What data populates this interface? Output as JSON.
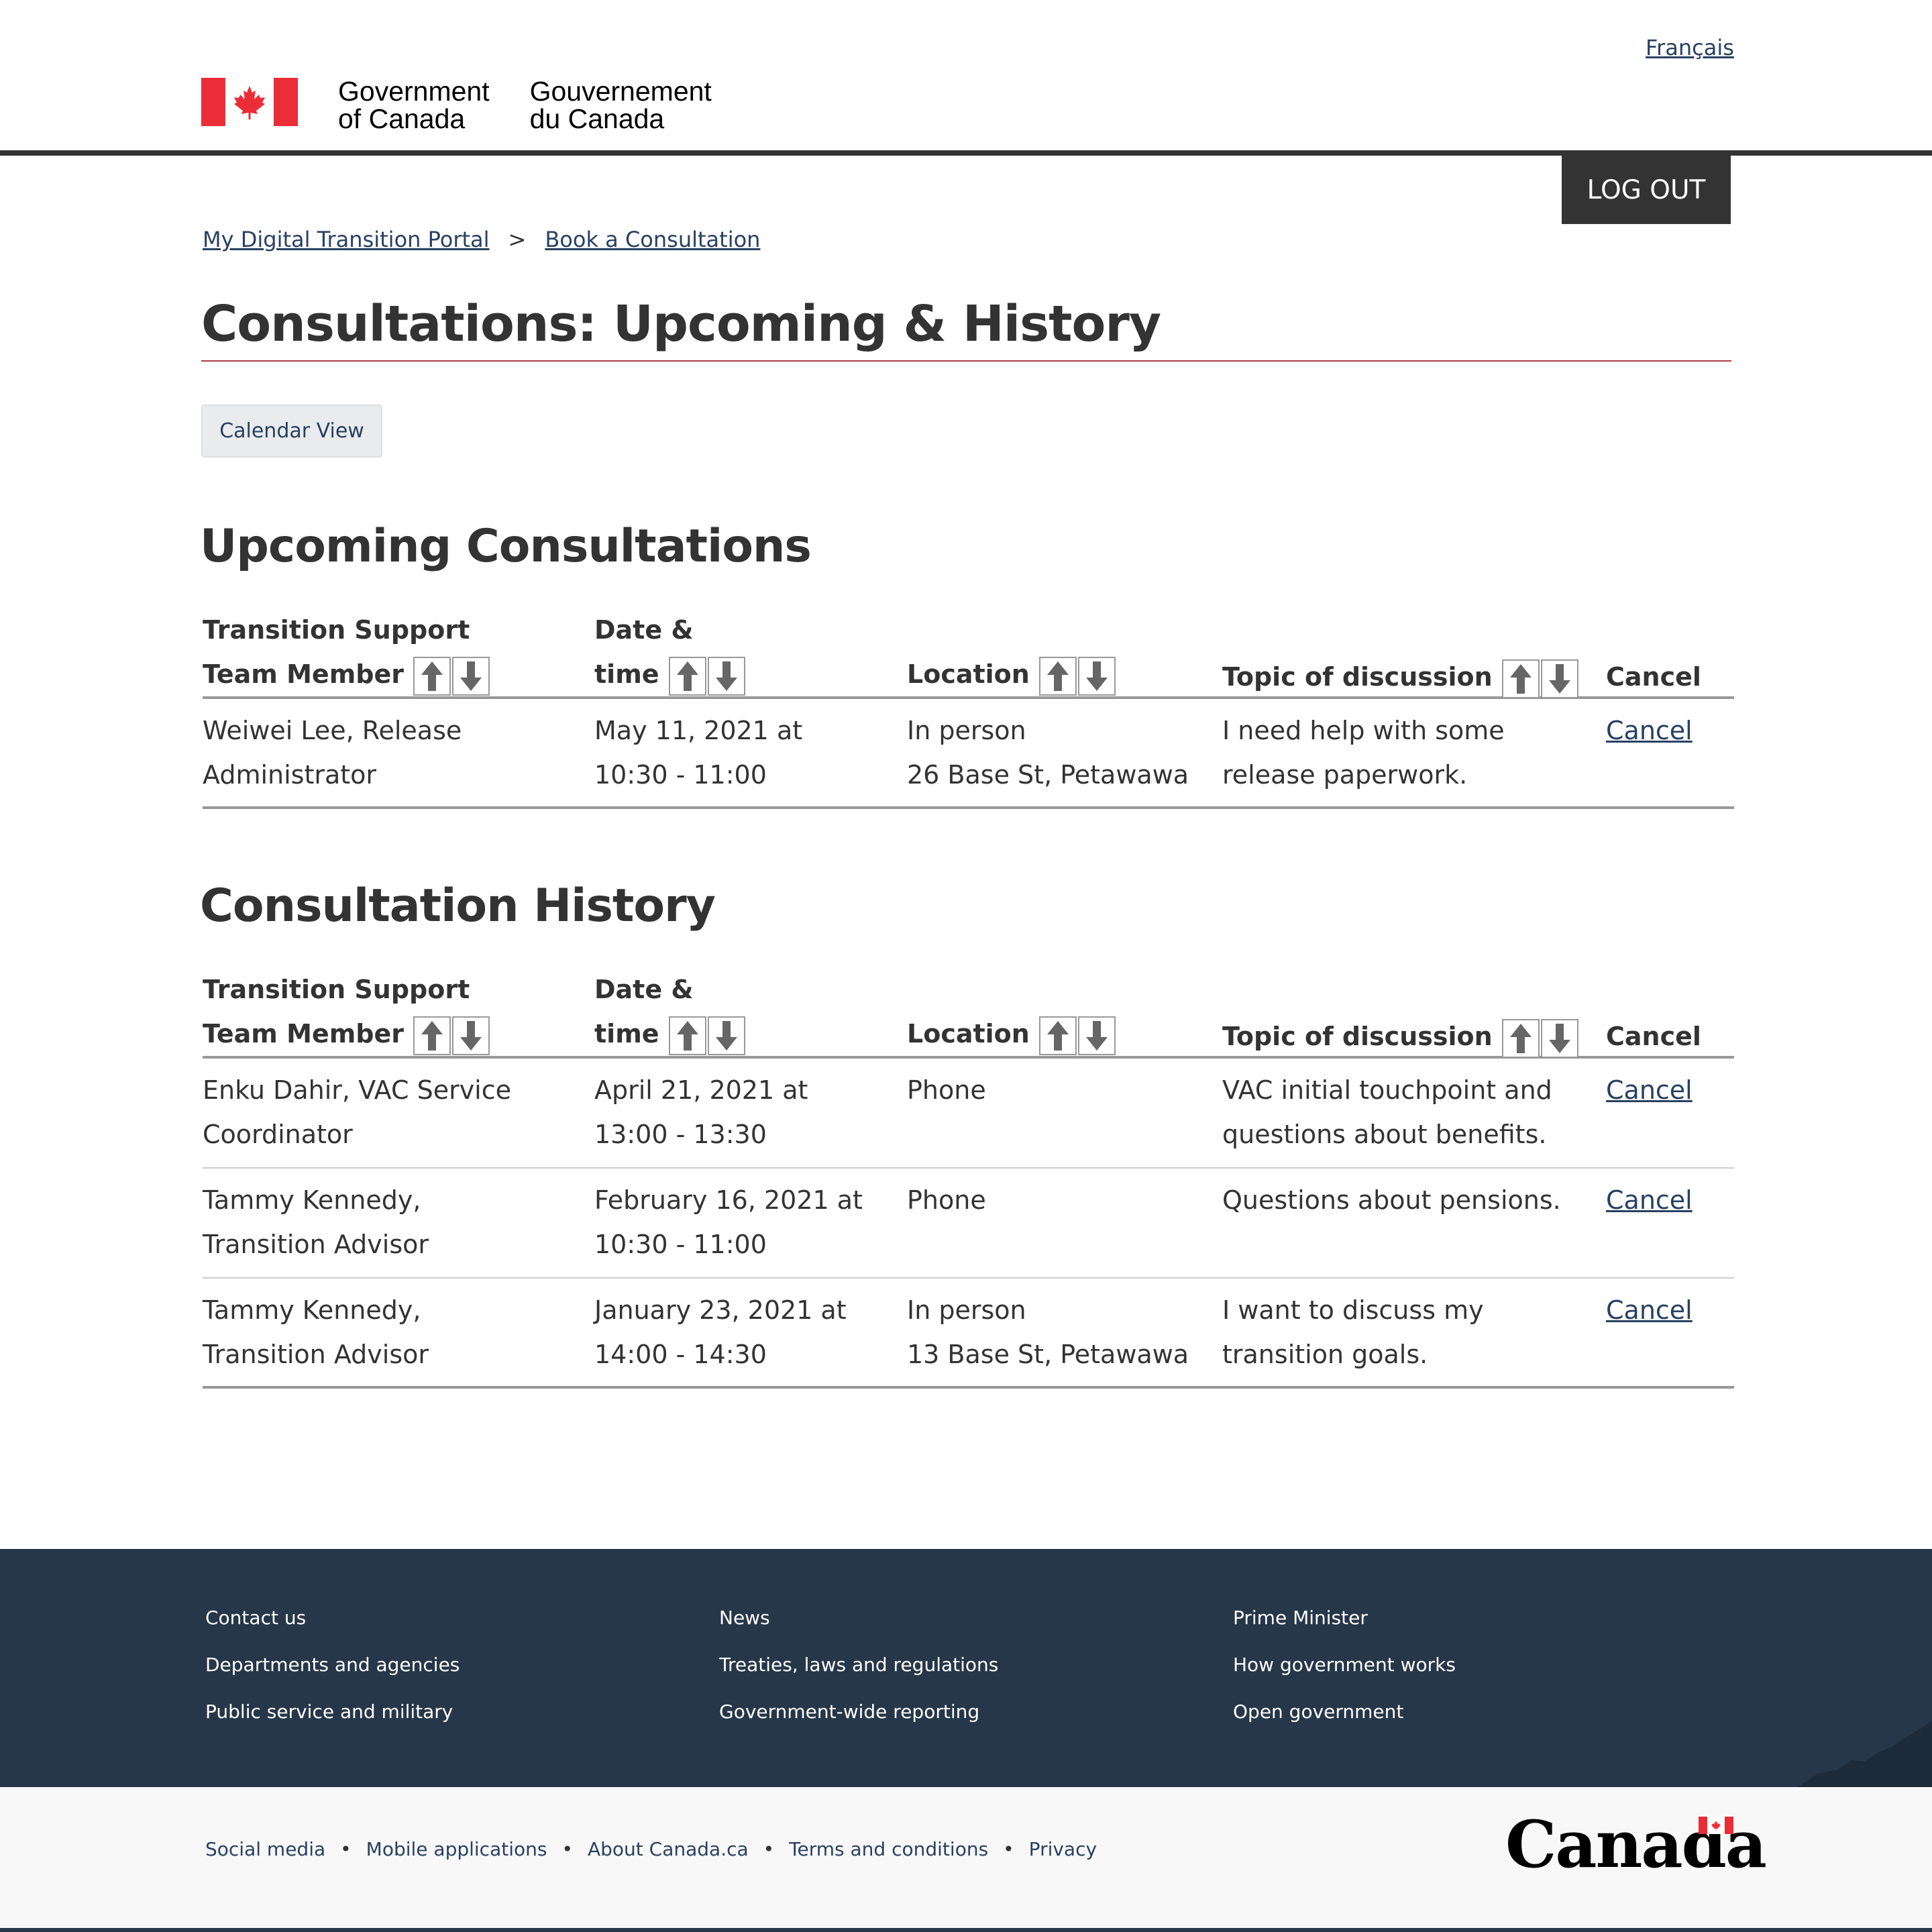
{
  "header": {
    "language_link": "Français",
    "signature_en_line1": "Government",
    "signature_en_line2": "of Canada",
    "signature_fr_line1": "Gouvernement",
    "signature_fr_line2": "du Canada",
    "logout_label": "LOG OUT"
  },
  "breadcrumb": {
    "items": [
      "My Digital Transition Portal",
      "Book a Consultation"
    ],
    "separator": ">"
  },
  "page": {
    "title": "Consultations: Upcoming & History",
    "calendar_button": "Calendar View"
  },
  "columns": {
    "member_line1": "Transition Support",
    "member_line2": "Team Member",
    "date_line1": "Date &",
    "date_line2": "time",
    "location": "Location",
    "topic": "Topic of discussion",
    "cancel": "Cancel"
  },
  "upcoming": {
    "title": "Upcoming Consultations",
    "rows": [
      {
        "member_line1": "Weiwei Lee, Release",
        "member_line2": "Administrator",
        "date_line1": "May 11, 2021 at",
        "date_line2": "10:30 - 11:00",
        "location_line1": "In person",
        "location_line2": "26 Base St, Petawawa",
        "topic_line1": "I need help with some",
        "topic_line2": "release paperwork.",
        "cancel": "Cancel"
      }
    ]
  },
  "history": {
    "title": "Consultation History",
    "rows": [
      {
        "member_line1": "Enku Dahir, VAC Service",
        "member_line2": "Coordinator",
        "date_line1": "April 21, 2021 at",
        "date_line2": "13:00 - 13:30",
        "location_line1": "Phone",
        "location_line2": "",
        "topic_line1": "VAC initial touchpoint and",
        "topic_line2": "questions about benefits.",
        "cancel": "Cancel"
      },
      {
        "member_line1": "Tammy Kennedy,",
        "member_line2": "Transition Advisor",
        "date_line1": "February 16, 2021 at",
        "date_line2": "10:30 - 11:00",
        "location_line1": "Phone",
        "location_line2": "",
        "topic_line1": "Questions about pensions.",
        "topic_line2": "",
        "cancel": "Cancel"
      },
      {
        "member_line1": "Tammy Kennedy,",
        "member_line2": "Transition Advisor",
        "date_line1": "January 23, 2021 at",
        "date_line2": "14:00 - 14:30",
        "location_line1": "In person",
        "location_line2": "13 Base St, Petawawa",
        "topic_line1": "I want to discuss my",
        "topic_line2": "transition goals.",
        "cancel": "Cancel"
      }
    ]
  },
  "footer": {
    "col1": [
      "Contact us",
      "Departments and agencies",
      "Public service and military"
    ],
    "col2": [
      "News",
      "Treaties, laws and regulations",
      "Government-wide reporting"
    ],
    "col3": [
      "Prime Minister",
      "How government works",
      "Open government"
    ],
    "sub_links": [
      "Social media",
      "Mobile applications",
      "About Canada.ca",
      "Terms and conditions",
      "Privacy"
    ],
    "wordmark": "Canada"
  },
  "colors": {
    "link": "#284162",
    "flag_red": "#eb2d37",
    "footer_bg": "#26374a",
    "title_rule": "#af3c43"
  }
}
